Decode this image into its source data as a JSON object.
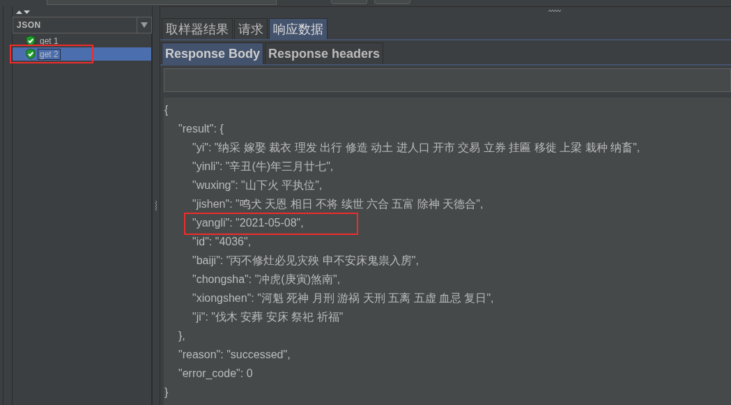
{
  "sidebar": {
    "renderer": "JSON",
    "items": [
      {
        "label": "get 1",
        "selected": false,
        "highlighted": false
      },
      {
        "label": "get 2",
        "selected": true,
        "highlighted": true
      }
    ]
  },
  "tabs": [
    {
      "label": "取样器结果",
      "selected": false
    },
    {
      "label": "请求",
      "selected": false
    },
    {
      "label": "响应数据",
      "selected": true
    }
  ],
  "subtabs": [
    {
      "label": "Response Body",
      "selected": true
    },
    {
      "label": "Response headers",
      "selected": false
    }
  ],
  "body": [
    {
      "text": "{",
      "highlighted": false,
      "children": [
        {
          "text": "\"result\": {",
          "highlighted": false,
          "children": [
            {
              "text": "\"yi\": \"纳采  嫁娶 裁衣 理发 出行 修造 动土 进人口 开市 交易 立券 挂匾 移徙 上梁 栽种 纳畜\",",
              "highlighted": false
            },
            {
              "text": "\"yinli\": \"辛丑(牛)年三月廿七\",",
              "highlighted": false
            },
            {
              "text": "\"wuxing\": \"山下火 平执位\",",
              "highlighted": false
            },
            {
              "text": "\"jishen\": \"鸣犬 天恩 相日 不将 续世 六合 五富 除神 天德合\",",
              "highlighted": false
            },
            {
              "text": "\"yangli\": \"2021-05-08\",",
              "highlighted": true
            },
            {
              "text": "\"id\": \"4036\",",
              "highlighted": false
            },
            {
              "text": "\"baiji\": \"丙不修灶必见灾殃 申不安床鬼祟入房\",",
              "highlighted": false
            },
            {
              "text": "\"chongsha\": \"冲虎(庚寅)煞南\",",
              "highlighted": false
            },
            {
              "text": "\"xiongshen\": \"河魁 死神 月刑 游祸 天刑 五离 五虚 血忌 复日\",",
              "highlighted": false
            },
            {
              "text": "\"ji\": \"伐木 安葬 安床 祭祀 祈福\"",
              "highlighted": false
            }
          ]
        },
        {
          "text": "},",
          "highlighted": false
        },
        {
          "text": "\"reason\": \"successed\",",
          "highlighted": false
        },
        {
          "text": "\"error_code\": 0",
          "highlighted": false
        }
      ]
    },
    {
      "text": "}",
      "highlighted": false
    }
  ]
}
